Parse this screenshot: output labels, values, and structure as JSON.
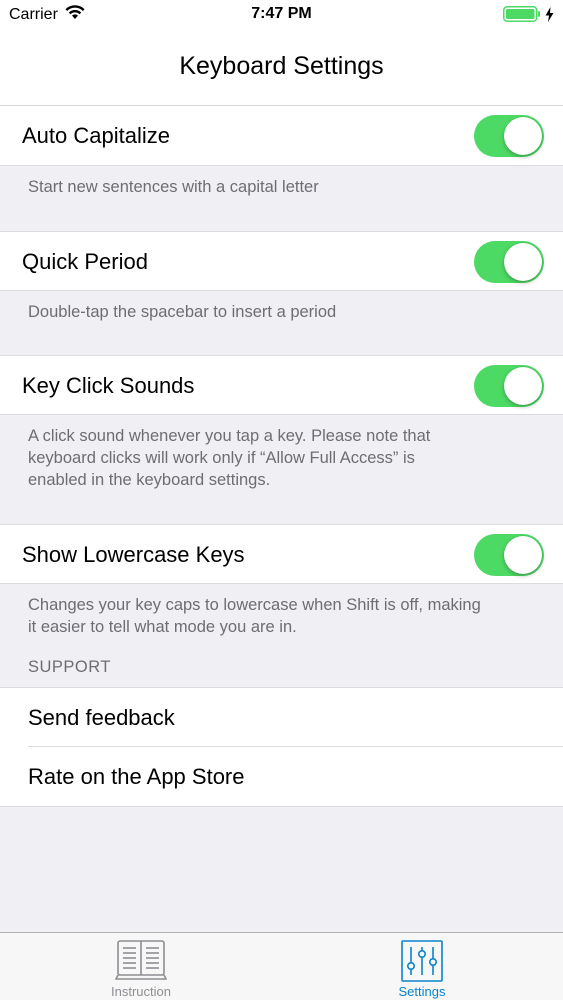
{
  "status_bar": {
    "carrier": "Carrier",
    "time": "7:47 PM"
  },
  "nav": {
    "title": "Keyboard Settings"
  },
  "settings": [
    {
      "label": "Auto Capitalize",
      "enabled": true,
      "description": [
        "Start new sentences with a capital letter"
      ]
    },
    {
      "label": "Quick Period",
      "enabled": true,
      "description": [
        "Double-tap the spacebar to insert a period"
      ]
    },
    {
      "label": "Key Click Sounds",
      "enabled": true,
      "description": [
        "A click sound whenever you tap a key. Please note that",
        "keyboard clicks will work only if “Allow Full Access” is",
        "enabled in the keyboard settings."
      ]
    },
    {
      "label": "Show Lowercase Keys",
      "enabled": true,
      "description": [
        "Changes your key caps to lowercase when Shift is off, making",
        "it easier to tell what mode you are in."
      ]
    }
  ],
  "support": {
    "header": "SUPPORT",
    "items": [
      "Send feedback",
      "Rate on the App Store"
    ]
  },
  "tab_bar": {
    "tabs": [
      {
        "label": "Instruction",
        "icon": "book-icon",
        "selected": false
      },
      {
        "label": "Settings",
        "icon": "sliders-icon",
        "selected": true
      }
    ]
  },
  "colors": {
    "toggle_on": "#4cd964",
    "tab_selected": "#0a84c8",
    "tab_unselected": "#8e8e93",
    "battery": "#4cd964"
  }
}
